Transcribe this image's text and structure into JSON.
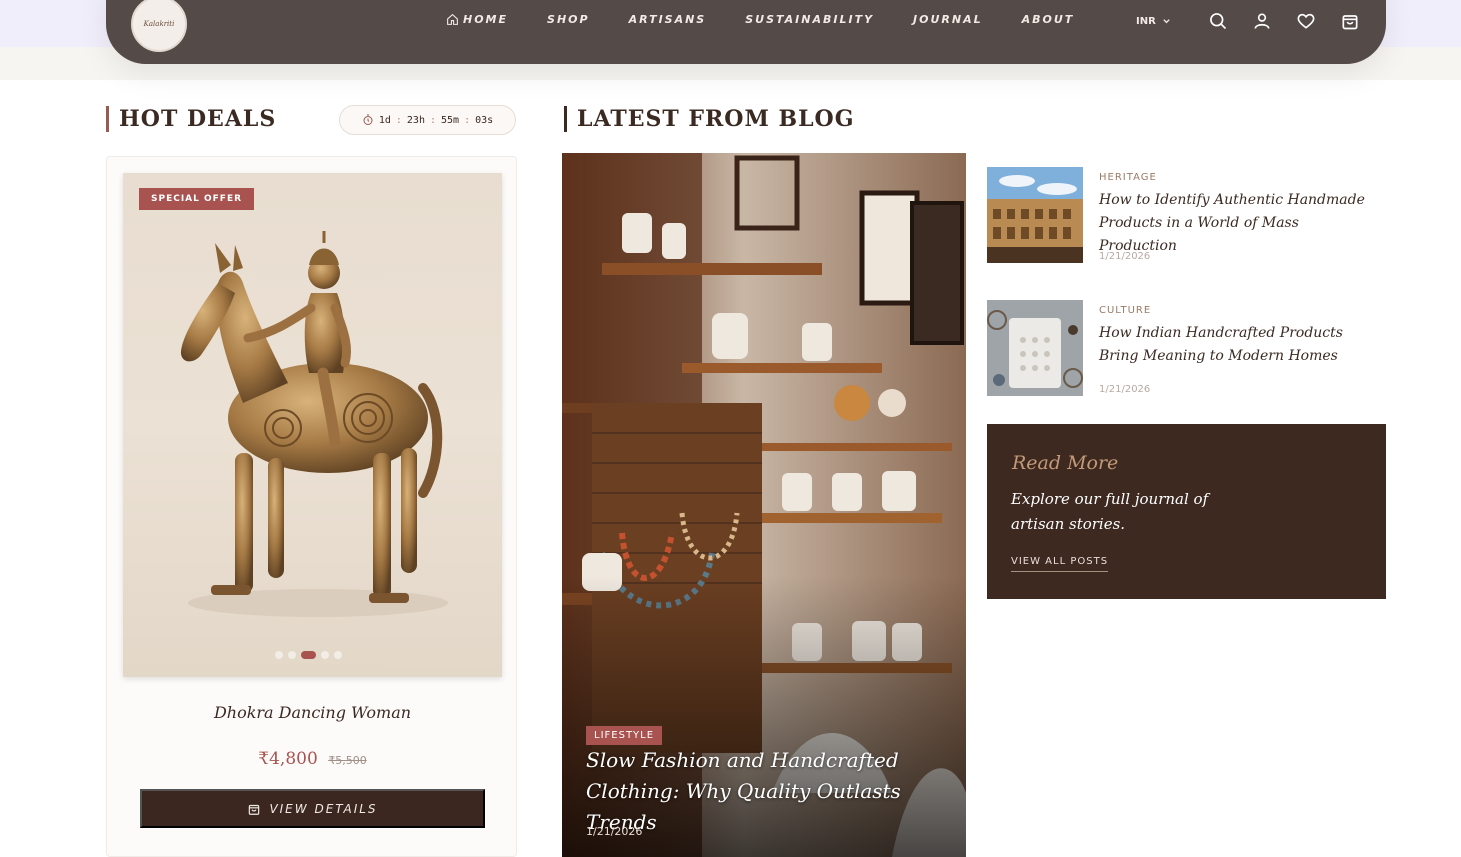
{
  "brand": {
    "logo_text": "Kalakriti"
  },
  "nav": {
    "links": [
      "HOME",
      "SHOP",
      "ARTISANS",
      "SUSTAINABILITY",
      "JOURNAL",
      "ABOUT"
    ],
    "currency": "INR",
    "icons": [
      "search-icon",
      "user-icon",
      "heart-icon",
      "bag-icon"
    ]
  },
  "hot_deals": {
    "title": "HOT DEALS",
    "timer": {
      "days": "1d",
      "hours": "23h",
      "minutes": "55m",
      "seconds": "03s",
      "sep": ":"
    },
    "card": {
      "badge": "SPECIAL OFFER",
      "name": "Dhokra Dancing Woman",
      "price": "₹4,800",
      "old_price": "₹5,500",
      "button": "VIEW DETAILS",
      "slides": 5,
      "active_slide": 3
    }
  },
  "blog": {
    "title": "LATEST FROM BLOG",
    "featured": {
      "category": "LIFESTYLE",
      "title": "Slow Fashion and Handcrafted Clothing: Why Quality Outlasts Trends",
      "date": "1/21/2026"
    },
    "posts": [
      {
        "category": "HERITAGE",
        "title": "How to Identify Authentic Handmade Products in a World of Mass Production",
        "date": "1/21/2026"
      },
      {
        "category": "CULTURE",
        "title": "How Indian Handcrafted Products Bring Meaning to Modern Homes",
        "date": "1/21/2026"
      }
    ],
    "read_more": {
      "label": "Read More",
      "text": "Explore our full journal of artisan stories.",
      "link": "VIEW ALL POSTS"
    }
  },
  "colors": {
    "accent": "#a8534f",
    "dark": "#3b271f",
    "nav": "#544a47"
  }
}
